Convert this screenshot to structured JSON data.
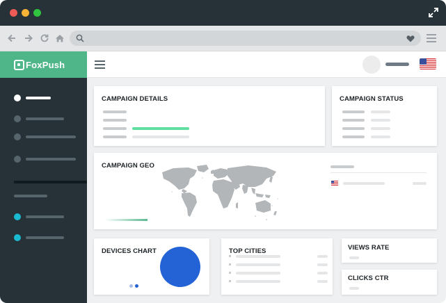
{
  "window": {
    "controls": [
      "close",
      "minimize",
      "maximize"
    ],
    "control_colors": [
      "#ee5a55",
      "#f5b234",
      "#2fc33f"
    ],
    "expand_icon": "expand-arrows-icon"
  },
  "browser": {
    "nav_icons": [
      "back-arrow-icon",
      "forward-arrow-icon",
      "refresh-icon",
      "home-icon"
    ],
    "address_icons": [
      "search-icon",
      "heart-icon"
    ],
    "menu_icon": "hamburger-menu-icon"
  },
  "app": {
    "brand": "FoxPush",
    "brand_color": "#4fb68a",
    "sidebar_bg": "#263238",
    "accent_teal": "#1ab9cf",
    "locale_flag": "us-flag-icon"
  },
  "cards": {
    "campaign_details": {
      "title": "CAMPAIGN DETAILS",
      "progress_color": "#5fe0a0"
    },
    "campaign_status": {
      "title": "CAMPAIGN STATUS"
    },
    "campaign_geo": {
      "title": "CAMPAIGN GEO",
      "legend_flag": "us-flag-icon"
    },
    "devices_chart": {
      "title": "DEVICES CHART",
      "pie_color": "#2363d6"
    },
    "top_cities": {
      "title": "TOP CITIES"
    },
    "views_rate": {
      "title": "VIEWS RATE"
    },
    "clicks_ctr": {
      "title": "CLICKS CTR"
    }
  }
}
